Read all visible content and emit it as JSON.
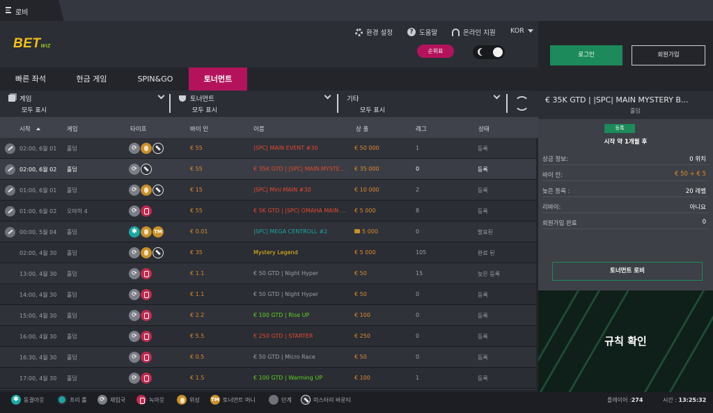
{
  "window_tab": {
    "label": "로비"
  },
  "brand": {
    "part1": "BET",
    "part2": "WIZ"
  },
  "header": {
    "settings": "환경 설정",
    "help": "도움말",
    "support": "온라인 지원",
    "language": "KOR",
    "ranking": "순위표"
  },
  "auth": {
    "login": "로그인",
    "register": "회원가입"
  },
  "tabs": [
    "빠른 좌석",
    "현금 게임",
    "SPIN&GO",
    "토너먼트"
  ],
  "active_tab": "토너먼트",
  "filters": [
    {
      "title": "게임",
      "value": "모두 표시"
    },
    {
      "title": "토너먼트",
      "value": "모두 표시"
    },
    {
      "title": "기타",
      "value": "모두 표시"
    }
  ],
  "columns": {
    "start": "시작",
    "game": "게임",
    "type": "타이프",
    "buyin": "바이 인",
    "name": "이름",
    "prize": "상 풀",
    "level": "레그",
    "status": "상태"
  },
  "rows": [
    {
      "start": "02:00, 6월 01",
      "game": "홀덤",
      "badges": [
        "re",
        "bo",
        "my"
      ],
      "buyin": "€ 55",
      "name": "|SPC| MAIN EVENT #30",
      "name_color": "#e64a2e",
      "prize": "€ 50 000",
      "level": "1",
      "status": "등록",
      "pin": true
    },
    {
      "start": "02:00, 6월 02",
      "game": "홀덤",
      "badges": [
        "re",
        "my"
      ],
      "buyin": "€ 55",
      "name": "€ 35K GTD | |SPC| MAIN MYSTE...",
      "name_color": "#e64a2e",
      "prize": "€ 35 000",
      "level": "0",
      "status": "등록",
      "pin": true,
      "selected": true
    },
    {
      "start": "01:00, 6월 01",
      "game": "홀덤",
      "badges": [
        "re",
        "bo",
        "my"
      ],
      "buyin": "€ 15",
      "name": "|SPC| Mini MAIN #30",
      "name_color": "#e64a2e",
      "prize": "€ 10 000",
      "level": "2",
      "status": "등록",
      "pin": true
    },
    {
      "start": "01:00, 6월 02",
      "game": "오마하 4",
      "badges": [
        "re",
        "ko"
      ],
      "buyin": "€ 55",
      "name": "€ 5K GTD | |SPC| OMAHA MAIN ...",
      "name_color": "#e64a2e",
      "prize": "€ 5 000",
      "level": "8",
      "status": "등록",
      "pin": true
    },
    {
      "start": "00:00, 5월 04",
      "game": "홀덤",
      "badges": [
        "fz",
        "bo",
        "tm"
      ],
      "buyin": "€ 0.01",
      "name": "|SPC| MEGA CENTROLL #2",
      "name_color": "#1aa7a4",
      "prize": "5 000",
      "prize_ticket": true,
      "level": "0",
      "status": "발표된",
      "pin": true
    },
    {
      "start": "02:00, 4월 30",
      "game": "홀덤",
      "badges": [
        "re",
        "bo",
        "my"
      ],
      "buyin": "€ 35",
      "name": "Mystery Legend",
      "name_color": "#f4c21a",
      "prize": "€ 5 000",
      "level": "105",
      "status": "완료 된"
    },
    {
      "start": "13:00, 4월 30",
      "game": "홀덤",
      "badges": [
        "re",
        "ko"
      ],
      "buyin": "€ 1.1",
      "name": "€ 50 GTD | Night Hyper",
      "name_color": "#9ca0a7",
      "prize": "€ 50",
      "level": "15",
      "status": "늦은 등록"
    },
    {
      "start": "14:00, 4월 30",
      "game": "홀덤",
      "badges": [
        "re",
        "ko"
      ],
      "buyin": "€ 1.1",
      "name": "€ 50 GTD | Night Hyper",
      "name_color": "#9ca0a7",
      "prize": "€ 50",
      "level": "0",
      "status": "등록"
    },
    {
      "start": "15:00, 4월 30",
      "game": "홀덤",
      "badges": [
        "re",
        "ko"
      ],
      "buyin": "€ 2.2",
      "name": "€ 100 GTD | Rise UP",
      "name_color": "#5fd321",
      "prize": "€ 100",
      "level": "0",
      "status": "등록"
    },
    {
      "start": "16:00, 4월 30",
      "game": "홀덤",
      "badges": [
        "re",
        "ko"
      ],
      "buyin": "€ 5.5",
      "name": "€ 250 GTD | STARTER",
      "name_color": "#e64a2e",
      "prize": "€ 250",
      "level": "0",
      "status": "등록"
    },
    {
      "start": "16:30, 4월 30",
      "game": "홀덤",
      "badges": [
        "re",
        "ko"
      ],
      "buyin": "€ 0.5",
      "name": "€ 50 GTD | Micro Race",
      "name_color": "#9ca0a7",
      "prize": "€ 50",
      "level": "0",
      "status": "등록"
    },
    {
      "start": "17:00, 4월 30",
      "game": "홀덤",
      "badges": [
        "re",
        "ko"
      ],
      "buyin": "€ 1.5",
      "name": "€ 100 GTD | Warming UP",
      "name_color": "#5fd321",
      "prize": "€ 100",
      "level": "1",
      "status": "등록"
    },
    {
      "start": "",
      "game": "",
      "badges": [
        "re",
        "ko"
      ],
      "buyin": "",
      "name": "",
      "name_color": "#9ca0a7",
      "prize": "",
      "level": "",
      "status": ""
    }
  ],
  "panel": {
    "title": "€ 35K GTD | |SPC| MAIN MYSTERY B...",
    "game": "홀덤",
    "badge": "등록",
    "starts": "시작 약 1개월 후",
    "info": [
      {
        "k": "상금 정보:",
        "v": "0 위치",
        "accent": false
      },
      {
        "k": "바이 인:",
        "v": "€ 50 + € 5",
        "accent": true
      },
      {
        "k": "늦은 등록 :",
        "v": "20 레벨",
        "accent": false
      },
      {
        "k": "리바이:",
        "v": "아니요",
        "accent": false
      },
      {
        "k": "회원가입 완료",
        "v": "0",
        "accent": false
      }
    ],
    "lobby": "토너먼트 로비",
    "rules": "규칙 확인"
  },
  "legend": [
    {
      "icon": "fz",
      "label": "동결아웃"
    },
    {
      "icon": "free",
      "label": "프리 롤"
    },
    {
      "icon": "re",
      "label": "재입국"
    },
    {
      "icon": "ko",
      "label": "녹아웃"
    },
    {
      "icon": "bo",
      "label": "위성"
    },
    {
      "icon": "tm",
      "label": "토너먼트 머니"
    },
    {
      "icon": "pin",
      "label": "단계"
    },
    {
      "icon": "my",
      "label": "미스터리 바운티"
    }
  ],
  "footer": {
    "players_label": "플레이어 :",
    "players": "274",
    "time_label": "시간 :",
    "time": "13:25:32"
  },
  "colors": {
    "accent_pink": "#b4135c",
    "green": "#1c8a5a",
    "buyin_orange": "#e08a2e"
  }
}
